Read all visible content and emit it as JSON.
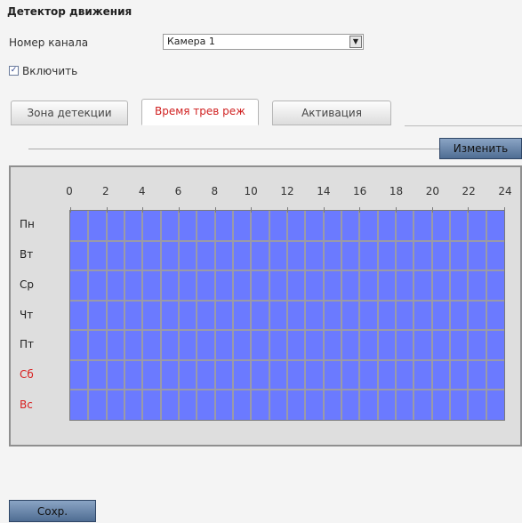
{
  "title": "Детектор движения",
  "channel": {
    "label": "Номер канала",
    "value": "Камера 1"
  },
  "enable": {
    "label": "Включить",
    "checked": true
  },
  "tabs": [
    {
      "label": "Зона детекции",
      "active": false
    },
    {
      "label": "Время трев реж",
      "active": true
    },
    {
      "label": "Активация",
      "active": false
    }
  ],
  "edit_button": "Изменить",
  "hours": [
    "0",
    "2",
    "4",
    "6",
    "8",
    "10",
    "12",
    "14",
    "16",
    "18",
    "20",
    "22",
    "24"
  ],
  "days": [
    {
      "label": "Пн",
      "weekend": false
    },
    {
      "label": "Вт",
      "weekend": false
    },
    {
      "label": "Ср",
      "weekend": false
    },
    {
      "label": "Чт",
      "weekend": false
    },
    {
      "label": "Пт",
      "weekend": false
    },
    {
      "label": "Сб",
      "weekend": true
    },
    {
      "label": "Вс",
      "weekend": true
    }
  ],
  "schedule": {
    "all_hours_selected": true,
    "selected_color": "#6b7aff",
    "weekend_color": "#d82020"
  },
  "save_button": "Сохр."
}
